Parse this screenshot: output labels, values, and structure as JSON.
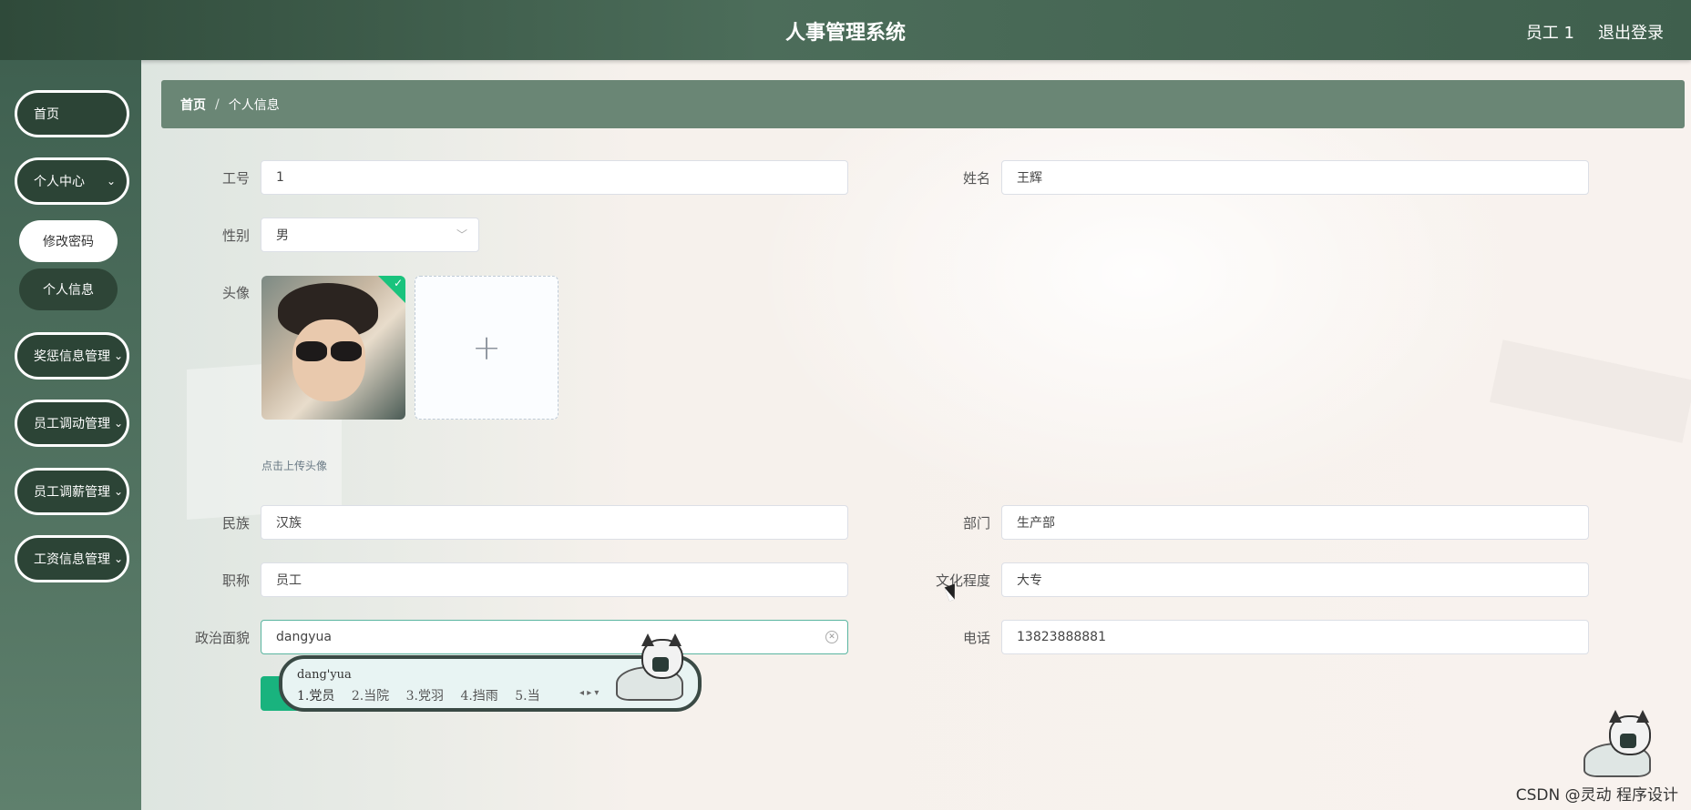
{
  "header": {
    "title": "人事管理系统",
    "user": "员工 1",
    "logout": "退出登录"
  },
  "sidebar": {
    "items": [
      {
        "label": "首页"
      },
      {
        "label": "个人中心",
        "arrow": "⌄"
      },
      {
        "label": "奖惩信息管理",
        "arrow": "⌄"
      },
      {
        "label": "员工调动管理",
        "arrow": "⌄"
      },
      {
        "label": "员工调薪管理",
        "arrow": "⌄"
      },
      {
        "label": "工资信息管理",
        "arrow": "⌄"
      }
    ],
    "sub_items": [
      {
        "label": "修改密码"
      },
      {
        "label": "个人信息"
      }
    ]
  },
  "breadcrumb": {
    "home": "首页",
    "separator": "/",
    "current": "个人信息"
  },
  "form": {
    "job_no": {
      "label": "工号",
      "value": "1"
    },
    "name": {
      "label": "姓名",
      "value": "王辉"
    },
    "gender": {
      "label": "性别",
      "value": "男"
    },
    "avatar": {
      "label": "头像",
      "tip": "点击上传头像"
    },
    "ethnicity": {
      "label": "民族",
      "value": "汉族"
    },
    "department": {
      "label": "部门",
      "value": "生产部"
    },
    "title": {
      "label": "职称",
      "value": "员工"
    },
    "education": {
      "label": "文化程度",
      "value": "大专"
    },
    "political": {
      "label": "政治面貌",
      "value": "dangyua"
    },
    "phone": {
      "label": "电话",
      "value": "13823888881"
    }
  },
  "ime": {
    "composition": "dang'yua",
    "candidates": [
      "1.党员",
      "2.当院",
      "3.党羽",
      "4.挡雨",
      "5.当"
    ]
  },
  "watermark": "CSDN @灵动 程序设计",
  "colors": {
    "header": "#3f5f4d",
    "sidebar": "#4f7060",
    "accent": "#19b37e"
  }
}
